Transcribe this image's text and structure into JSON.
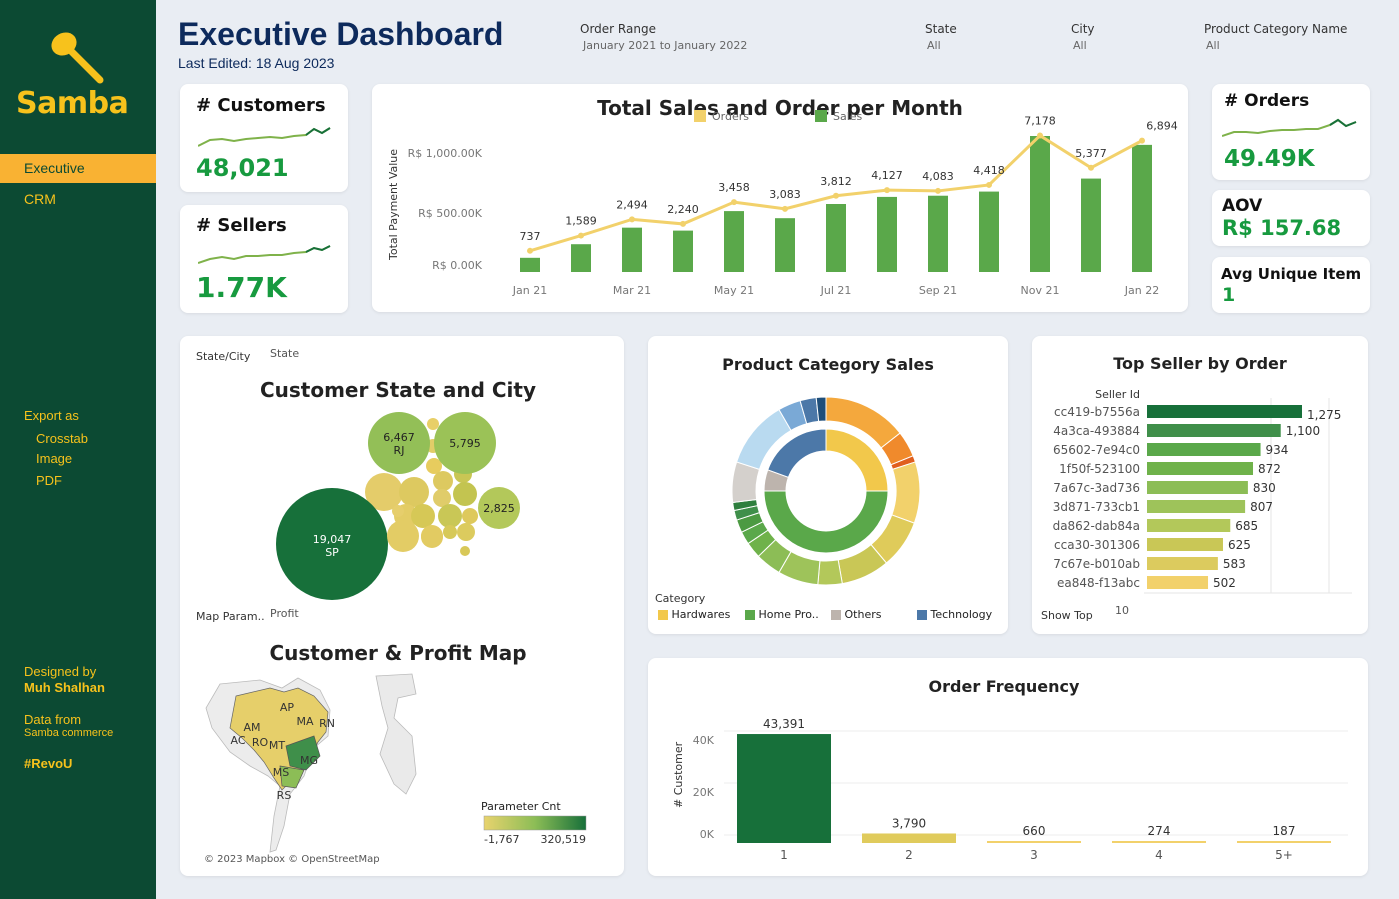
{
  "sidebar": {
    "logo": "Samba",
    "nav": [
      {
        "label": "Executive"
      },
      {
        "label": "CRM"
      }
    ],
    "export_title": "Export as",
    "export_items": [
      "Crosstab",
      "Image",
      "PDF"
    ],
    "designed_by": "Designed by",
    "author": "Muh Shalhan",
    "data_from": "Data from",
    "data_source": "Samba commerce",
    "hashtag": "#RevoU"
  },
  "header": {
    "title": "Executive Dashboard",
    "subtitle": "Last Edited: 18 Aug 2023",
    "filters": [
      {
        "label": "Order Range",
        "value": "January 2021 to January 2022"
      },
      {
        "label": "State",
        "value": "All"
      },
      {
        "label": "City",
        "value": "All"
      },
      {
        "label": "Product Category Name",
        "value": "All"
      }
    ]
  },
  "kpis": {
    "customers": {
      "title": "# Customers",
      "value": "48,021"
    },
    "sellers": {
      "title": "# Sellers",
      "value": "1.77K"
    },
    "orders": {
      "title": "# Orders",
      "value": "49.49K"
    },
    "aov": {
      "title": "AOV",
      "value": "R$ 157.68"
    },
    "avg_unique": {
      "title": "Avg Unique Item",
      "value": "1"
    }
  },
  "sales_chart": {
    "title": "Total Sales and Order per Month",
    "legend_orders": "Orders",
    "legend_sales": "Sales",
    "ylabel": "Total Payment Value",
    "y_ticks": [
      "R$ 0.00K",
      "R$ 500.00K",
      "R$ 1,000.00K"
    ],
    "x_ticks": [
      "Jan 21",
      "Mar 21",
      "May 21",
      "Jul 21",
      "Sep 21",
      "Nov 21",
      "Jan 22"
    ]
  },
  "bubble": {
    "param_label": "State/City",
    "param_value": "State",
    "title": "Customer State and City",
    "labels": {
      "sp": "19,047",
      "sp_state": "SP",
      "rj": "6,467",
      "rj_state": "RJ",
      "b3": "5,795",
      "b4": "2,825"
    }
  },
  "map": {
    "param_label": "Map Param..",
    "param_value": "Profit",
    "title": "Customer & Profit Map",
    "states": [
      "AM",
      "AP",
      "AC",
      "RO",
      "MT",
      "MA",
      "RN",
      "MG",
      "MS",
      "RS"
    ],
    "legend_title": "Parameter Cnt",
    "legend_min": "-1,767",
    "legend_max": "320,519",
    "attribution": "© 2023 Mapbox © OpenStreetMap"
  },
  "category": {
    "title": "Product Category Sales",
    "legend_title": "Category",
    "legend": [
      {
        "label": "Hardwares",
        "color": "#f2c84b"
      },
      {
        "label": "Home Pro..",
        "color": "#5aa84a"
      },
      {
        "label": "Others",
        "color": "#bdb4ad"
      },
      {
        "label": "Technology",
        "color": "#4c78a8"
      }
    ]
  },
  "top_seller": {
    "title": "Top Seller by Order",
    "col_label": "Seller Id",
    "show_top_label": "Show Top",
    "show_top_value": "10"
  },
  "order_freq": {
    "title": "Order Frequency",
    "ylabel": "# Customer",
    "y_ticks": [
      "0K",
      "20K",
      "40K"
    ]
  },
  "chart_data": [
    {
      "type": "bar",
      "title": "Total Sales and Order per Month",
      "ylabel": "Total Payment Value",
      "categories": [
        "Jan 21",
        "Feb 21",
        "Mar 21",
        "Apr 21",
        "May 21",
        "Jun 21",
        "Jul 21",
        "Aug 21",
        "Sep 21",
        "Oct 21",
        "Nov 21",
        "Dec 21",
        "Jan 22"
      ],
      "series": [
        {
          "name": "Sales",
          "type": "bar",
          "values": [
            120,
            235,
            375,
            350,
            515,
            455,
            575,
            635,
            645,
            680,
            1150,
            790,
            1075
          ]
        },
        {
          "name": "Orders",
          "type": "line",
          "values": [
            737,
            1589,
            2494,
            2240,
            3458,
            3083,
            3812,
            4127,
            4083,
            4418,
            7178,
            5377,
            6894
          ]
        }
      ],
      "ylim": [
        0,
        1150
      ]
    },
    {
      "type": "bar",
      "title": "Top Seller by Order",
      "categories": [
        "cc419-b7556a",
        "4a3ca-493884",
        "65602-7e94c0",
        "1f50f-523100",
        "7a67c-3ad736",
        "3d871-733cb1",
        "da862-dab84a",
        "cca30-301306",
        "7c67e-b010ab",
        "ea848-f13abc"
      ],
      "values": [
        1275,
        1100,
        934,
        872,
        830,
        807,
        685,
        625,
        583,
        502
      ]
    },
    {
      "type": "bar",
      "title": "Order Frequency",
      "ylabel": "# Customer",
      "categories": [
        "1",
        "2",
        "3",
        "4",
        "5+"
      ],
      "values": [
        43391,
        3790,
        660,
        274,
        187
      ],
      "ylim": [
        0,
        45000
      ]
    },
    {
      "type": "pie",
      "title": "Product Category Sales",
      "categories": [
        "Hardwares",
        "Home Pro..",
        "Others",
        "Technology"
      ],
      "values": [
        25,
        50,
        6,
        19
      ]
    }
  ]
}
